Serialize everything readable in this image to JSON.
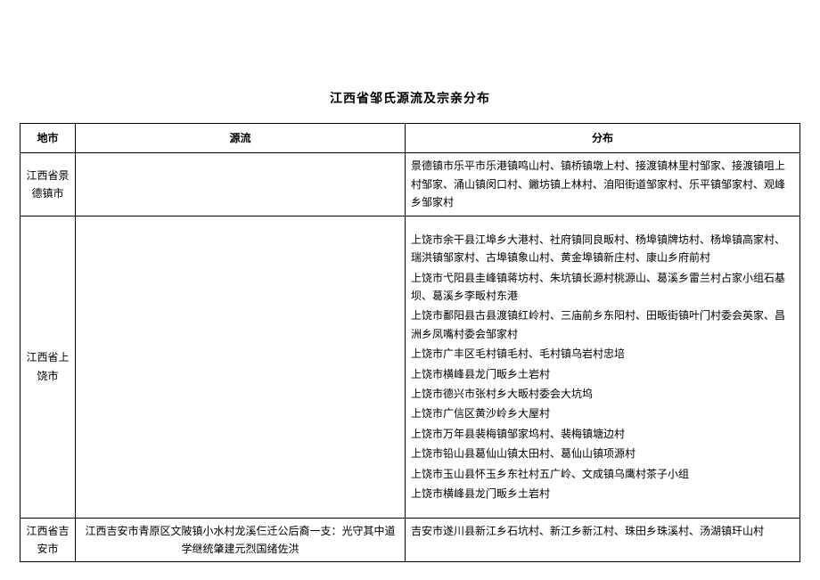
{
  "title": "江西省邹氏源流及宗亲分布",
  "headers": {
    "city": "地市",
    "origin": "源流",
    "distribution": "分布"
  },
  "rows": [
    {
      "city": "江西省景德镇市",
      "origin": "",
      "distribution_lines": [
        "景德镇市乐平市乐港镇鸣山村、镇桥镇墩上村、接渡镇林里村邹家、接渡镇咀上村邹家、涌山镇闵口村、䥕坊镇上林村、洎阳街道邹家村、乐平镇邹家村、观峰乡邹家村"
      ]
    },
    {
      "city": "江西省上饶市",
      "origin": "",
      "distribution_lines": [
        "上饶市余干县江埠乡大港村、社府镇同良畈村、杨埠镇牌坊村、杨埠镇高家村、瑞洪镇邹家村、古埠镇象山村、黄金埠镇新庄村、康山乡府前村",
        "上饶市弋阳县圭峰镇蒋坊村、朱坑镇长源村桃源山、葛溪乡雷兰村占家小组石基坝、葛溪乡李畈村东港",
        "上饶市鄱阳县古县渡镇红岭村、三庙前乡东阳村、田畈街镇叶门村委会英家、昌洲乡凤嘴村委会邹家村",
        "上饶市广丰区毛村镇毛村、毛村镇乌岩村忠培",
        "上饶市横峰县龙门畈乡土岩村",
        "上饶市德兴市张村乡大畈村委会大坑坞",
        "上饶市广信区黄沙岭乡大屋村",
        "上饶市万年县裴梅镇邹家坞村、裴梅镇塘边村",
        "上饶市铅山县葛仙山镇太田村、葛仙山镇项源村",
        "上饶市玉山县怀玉乡东社村五广岭、文成镇乌鹰村茶子小组",
        "上饶市横峰县龙门畈乡土岩村"
      ]
    },
    {
      "city": "江西省吉安市",
      "origin": "江西吉安市青原区文陂镇小水村龙溪仨迁公后裔一支：光守其中道学继统肇建元烈国绪佐洪",
      "distribution_lines": [
        "吉安市遂川县新江乡石坑村、新江乡新江村、珠田乡珠溪村、汤湖镇玕山村"
      ]
    }
  ]
}
